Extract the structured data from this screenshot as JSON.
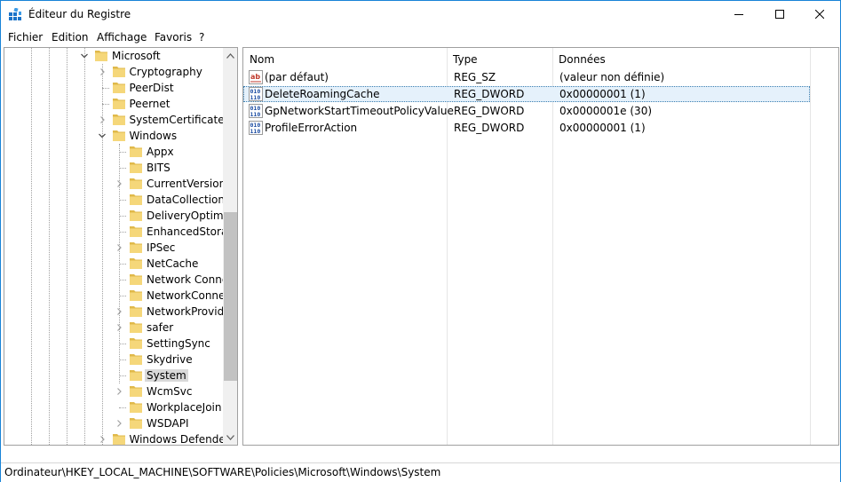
{
  "window": {
    "title": "Éditeur du Registre",
    "icon": "registry-editor-icon",
    "controls": [
      "minimize-icon",
      "maximize-icon",
      "close-icon"
    ]
  },
  "menu": {
    "items": [
      "Fichier",
      "Edition",
      "Affichage",
      "Favoris",
      "?"
    ]
  },
  "tree": {
    "items": [
      {
        "label": "Microsoft",
        "expander": "expanded",
        "selected": false
      },
      {
        "label": "Cryptography",
        "expander": "collapsed",
        "selected": false
      },
      {
        "label": "PeerDist",
        "expander": "none",
        "selected": false
      },
      {
        "label": "Peernet",
        "expander": "none",
        "selected": false
      },
      {
        "label": "SystemCertificates",
        "expander": "collapsed",
        "selected": false
      },
      {
        "label": "Windows",
        "expander": "expanded",
        "selected": false
      },
      {
        "label": "Appx",
        "expander": "none",
        "selected": false
      },
      {
        "label": "BITS",
        "expander": "none",
        "selected": false
      },
      {
        "label": "CurrentVersion",
        "expander": "collapsed",
        "selected": false
      },
      {
        "label": "DataCollection",
        "expander": "none",
        "selected": false
      },
      {
        "label": "DeliveryOptimizat",
        "expander": "none",
        "selected": false
      },
      {
        "label": "EnhancedStorage",
        "expander": "none",
        "selected": false
      },
      {
        "label": "IPSec",
        "expander": "collapsed",
        "selected": false
      },
      {
        "label": "NetCache",
        "expander": "none",
        "selected": false
      },
      {
        "label": "Network Connect",
        "expander": "none",
        "selected": false
      },
      {
        "label": "NetworkConnectiv",
        "expander": "none",
        "selected": false
      },
      {
        "label": "NetworkProvider",
        "expander": "collapsed",
        "selected": false
      },
      {
        "label": "safer",
        "expander": "collapsed",
        "selected": false
      },
      {
        "label": "SettingSync",
        "expander": "none",
        "selected": false
      },
      {
        "label": "Skydrive",
        "expander": "none",
        "selected": false
      },
      {
        "label": "System",
        "expander": "none",
        "selected": true
      },
      {
        "label": "WcmSvc",
        "expander": "collapsed",
        "selected": false
      },
      {
        "label": "WorkplaceJoin",
        "expander": "none",
        "selected": false
      },
      {
        "label": "WSDAPI",
        "expander": "collapsed",
        "selected": false
      },
      {
        "label": "Windows Defender",
        "expander": "collapsed",
        "selected": false
      }
    ]
  },
  "list": {
    "columns": [
      "Nom",
      "Type",
      "Données"
    ],
    "rows": [
      {
        "name": "(par défaut)",
        "type": "REG_SZ",
        "data": "(valeur non définie)",
        "icon": "string-value-icon",
        "selected": false
      },
      {
        "name": "DeleteRoamingCache",
        "type": "REG_DWORD",
        "data": "0x00000001 (1)",
        "icon": "binary-value-icon",
        "selected": true
      },
      {
        "name": "GpNetworkStartTimeoutPolicyValue",
        "type": "REG_DWORD",
        "data": "0x0000001e (30)",
        "icon": "binary-value-icon",
        "selected": false
      },
      {
        "name": "ProfileErrorAction",
        "type": "REG_DWORD",
        "data": "0x00000001 (1)",
        "icon": "binary-value-icon",
        "selected": false
      }
    ]
  },
  "status": {
    "path": "Ordinateur\\HKEY_LOCAL_MACHINE\\SOFTWARE\\Policies\\Microsoft\\Windows\\System"
  },
  "colors": {
    "folder": "#f5d77a",
    "folder_shade": "#e0b94a",
    "selection": "#e5f1fb",
    "selection_border": "#3c7fb1",
    "tree_selected": "#d9d9d9",
    "window_border": "#1883d7"
  }
}
